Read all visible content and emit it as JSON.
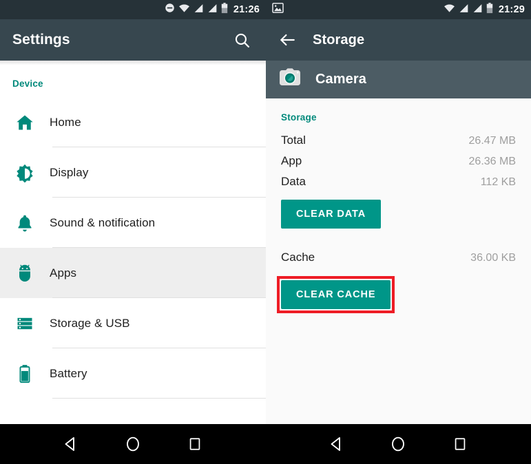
{
  "left_phone": {
    "status_bar": {
      "icons": [
        "do-not-disturb-icon",
        "wifi-icon",
        "signal-icon",
        "signal-icon",
        "battery-icon"
      ],
      "time": "21:26"
    },
    "toolbar": {
      "title": "Settings",
      "search_icon": "search-icon"
    },
    "section_header": "Device",
    "items": [
      {
        "label": "Home",
        "icon": "home-icon",
        "selected": false
      },
      {
        "label": "Display",
        "icon": "brightness-icon",
        "selected": false
      },
      {
        "label": "Sound & notification",
        "icon": "bell-icon",
        "selected": false
      },
      {
        "label": "Apps",
        "icon": "android-icon",
        "selected": true
      },
      {
        "label": "Storage & USB",
        "icon": "storage-icon",
        "selected": false
      },
      {
        "label": "Battery",
        "icon": "battery-icon",
        "selected": false
      }
    ],
    "nav_bar": {
      "back": "back-triangle-icon",
      "home": "home-circle-icon",
      "recents": "recents-square-icon"
    }
  },
  "right_phone": {
    "status_bar": {
      "notification_icon": "image-icon",
      "icons": [
        "wifi-icon",
        "signal-icon",
        "signal-icon",
        "battery-icon"
      ],
      "time": "21:29"
    },
    "toolbar": {
      "back_icon": "arrow-back-icon",
      "title": "Storage"
    },
    "app_band": {
      "app_icon": "camera-icon",
      "app_name": "Camera"
    },
    "storage": {
      "section_header": "Storage",
      "rows": [
        {
          "key": "Total",
          "value": "26.47 MB"
        },
        {
          "key": "App",
          "value": "26.36 MB"
        },
        {
          "key": "Data",
          "value": "112 KB"
        }
      ],
      "clear_data_label": "CLEAR DATA"
    },
    "cache": {
      "key": "Cache",
      "value": "36.00 KB",
      "clear_cache_label": "CLEAR CACHE"
    },
    "nav_bar": {
      "back": "back-triangle-icon",
      "home": "home-circle-icon",
      "recents": "recents-square-icon"
    }
  },
  "colors": {
    "accent_teal": "#009688",
    "section_header_teal": "#00897b",
    "toolbar_dark": "#37474f",
    "status_bar_dark": "#263238",
    "app_band": "#4c5c64",
    "highlight_red": "#ee1c25",
    "selected_row": "#eeeeee"
  }
}
